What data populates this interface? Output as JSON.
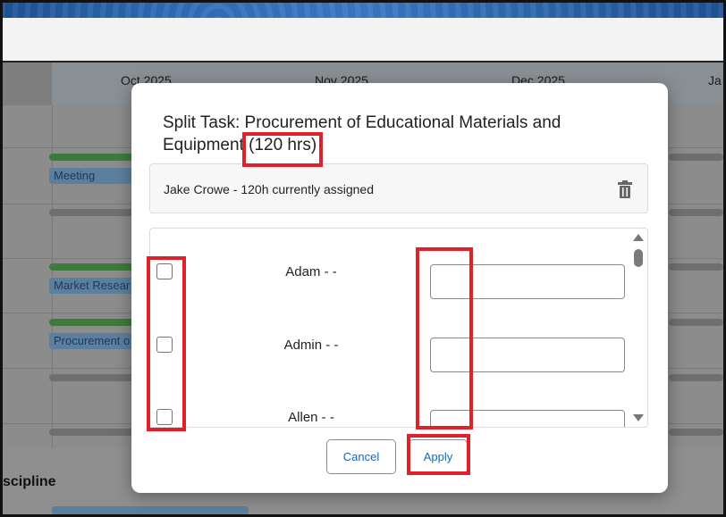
{
  "timeline": {
    "months": [
      "Oct 2025",
      "Nov 2025",
      "Dec 2025",
      "Ja"
    ],
    "task_labels": [
      "Meeting",
      "Market Resear",
      "Procurement o"
    ],
    "section_heading": "scipline"
  },
  "modal": {
    "title": "Split Task: Procurement of Educational Materials and Equipment (120 hrs)",
    "assigned_text": "Jake Crowe - 120h currently assigned",
    "delete_icon": "trash-icon",
    "people": [
      {
        "name": "Adam - -",
        "checked": false,
        "hours": ""
      },
      {
        "name": "Admin - -",
        "checked": false,
        "hours": ""
      },
      {
        "name": "Allen - -",
        "checked": false,
        "hours": ""
      }
    ],
    "cancel_label": "Cancel",
    "apply_label": "Apply"
  },
  "colors": {
    "annotation": "#e0202a",
    "button_text": "#0b6bcb",
    "progress_bar": "#3d7a3d",
    "task_label_bg": "#5b7f9e"
  }
}
